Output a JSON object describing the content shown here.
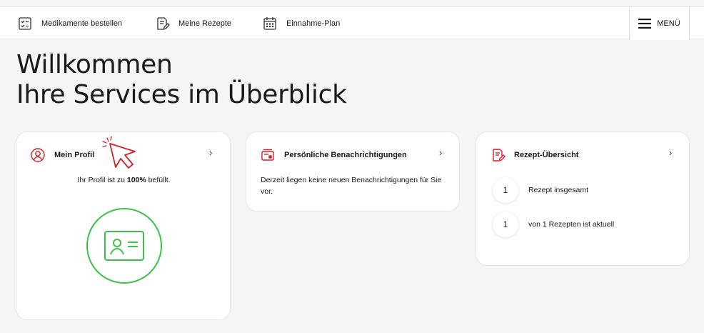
{
  "nav": {
    "items": [
      {
        "label": "Medikamente bestellen",
        "icon": "checklist-icon"
      },
      {
        "label": "Meine Rezepte",
        "icon": "prescription-edit-icon"
      },
      {
        "label": "Einnahme-Plan",
        "icon": "calendar-icon"
      }
    ],
    "menu_label": "MENÜ"
  },
  "heading": {
    "line1": "Willkommen",
    "line2": "Ihre Services im Überblick"
  },
  "cards": {
    "profile": {
      "title": "Mein Profil",
      "text_prefix": "Ihr Profil ist zu",
      "percent": "100%",
      "text_suffix": "befüllt.",
      "completion": 1.0
    },
    "notifications": {
      "title": "Persönliche Benachrichtigungen",
      "text": "Derzeit liegen keine neuen Benachrichtigungen für Sie vor."
    },
    "prescriptions": {
      "title": "Rezept-Übersicht",
      "rows": [
        {
          "count": "1",
          "label": "Rezept insgesamt"
        },
        {
          "count": "1",
          "label": "von 1 Rezepten ist aktuell"
        }
      ]
    }
  },
  "colors": {
    "accent_red": "#d6202a",
    "success_green": "#3cc24a",
    "background": "#f5f5f5"
  }
}
